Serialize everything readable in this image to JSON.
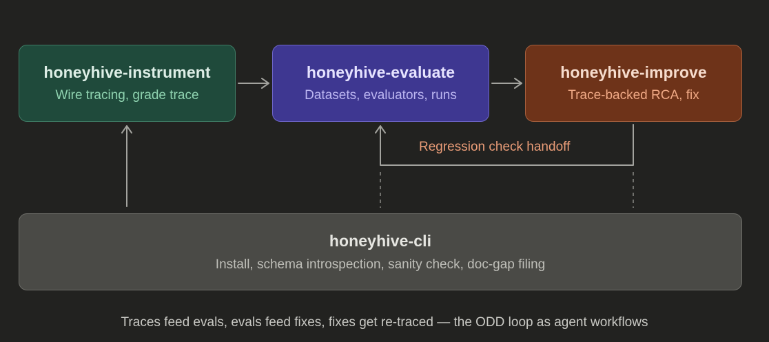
{
  "nodes": {
    "instrument": {
      "title": "honeyhive-instrument",
      "subtitle": "Wire tracing, grade trace"
    },
    "evaluate": {
      "title": "honeyhive-evaluate",
      "subtitle": "Datasets, evaluators, runs"
    },
    "improve": {
      "title": "honeyhive-improve",
      "subtitle": "Trace-backed RCA, fix"
    },
    "cli": {
      "title": "honeyhive-cli",
      "subtitle": "Install, schema introspection, sanity check, doc-gap filing"
    }
  },
  "edges": {
    "regression_label": "Regression check handoff"
  },
  "caption": "Traces feed evals, evals feed fixes, fixes get re-traced — the ODD loop as agent workflows",
  "colors": {
    "background": "#222220",
    "connector": "#a3a39e",
    "instrument_fill": "#1f4a3b",
    "evaluate_fill": "#3e3791",
    "improve_fill": "#6e3319",
    "cli_fill": "#4a4a46",
    "edge_label": "#eb9d78"
  }
}
